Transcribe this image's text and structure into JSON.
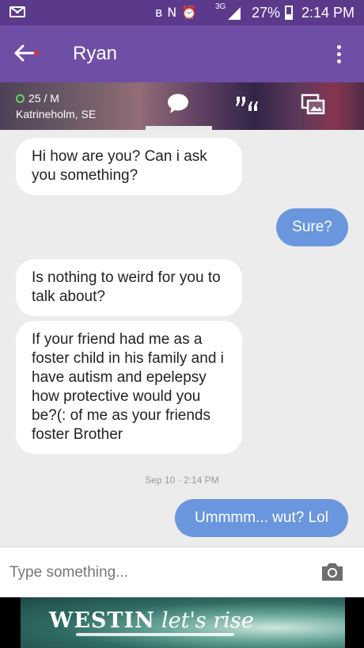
{
  "status_bar": {
    "network": "3G",
    "battery_percent": "27%",
    "time": "2:14 PM"
  },
  "header": {
    "title": "Ryan"
  },
  "profile": {
    "age_gender": "25 / M",
    "location": "Katrineholm, SE",
    "online": true,
    "tabs": [
      {
        "name": "chat-bubble-icon",
        "active": true
      },
      {
        "name": "quote-icon",
        "active": false
      },
      {
        "name": "photos-icon",
        "active": false
      }
    ]
  },
  "messages": [
    {
      "direction": "incoming",
      "text": "Hi how are you? Can i ask you something?"
    },
    {
      "direction": "outgoing",
      "text": "Sure?"
    },
    {
      "direction": "incoming",
      "text": "Is nothing to weird for you to talk about?"
    },
    {
      "direction": "incoming",
      "text": "If your friend had me as a foster child in his family and i have autism and epelepsy how protective would you be?(: of me as your friends foster Brother"
    },
    {
      "direction": "outgoing",
      "text": "Ummmm... wut? Lol"
    }
  ],
  "timestamp": "Sep 10 · 2:14 PM",
  "composer": {
    "placeholder": "Type something..."
  },
  "ad": {
    "brand": "WESTIN",
    "tagline": "let's rise"
  },
  "colors": {
    "status_bar": "#5b3a8c",
    "header": "#6f4ea5",
    "outgoing_bubble": "#6a96de",
    "incoming_bubble": "#ffffff",
    "online_dot": "#5ed65b"
  }
}
